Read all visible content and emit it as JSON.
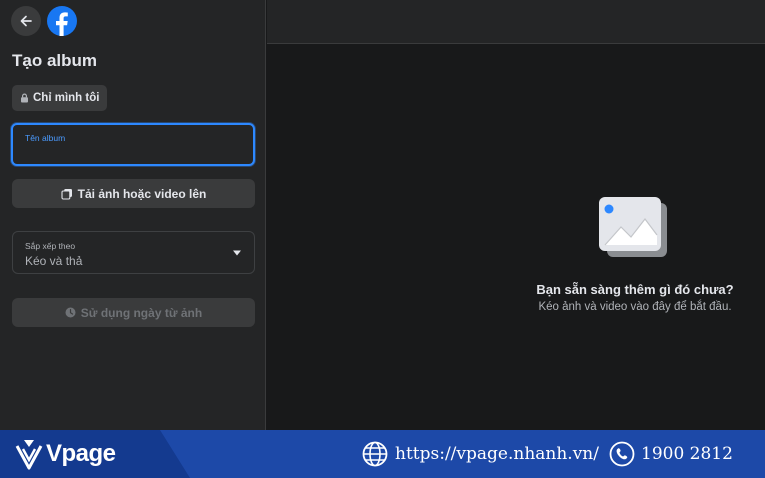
{
  "sidebar": {
    "back_icon": "arrow-left-icon",
    "logo_icon": "facebook-logo-icon",
    "title": "Tạo album",
    "privacy": {
      "icon": "lock-icon",
      "label": "Chỉ mình tôi"
    },
    "album_name": {
      "label": "Tên album",
      "value": ""
    },
    "upload": {
      "icon": "photo-stack-icon",
      "label": "Tải ảnh hoặc video lên"
    },
    "sort": {
      "label": "Sắp xếp theo",
      "value": "Kéo và thả",
      "icon": "caret-down-icon"
    },
    "use_date": {
      "icon": "clock-icon",
      "label": "Sử dụng ngày từ ảnh"
    }
  },
  "main": {
    "empty_icon": "photo-placeholder-icon",
    "empty_title": "Bạn sẵn sàng thêm gì đó chưa?",
    "empty_subtitle": "Kéo ảnh và video vào đây để bắt đầu."
  },
  "footer": {
    "brand": "Vpage",
    "brand_icon": "vpage-logo-icon",
    "website_icon": "globe-icon",
    "website": "https://vpage.nhanh.vn/",
    "phone_icon": "phone-icon",
    "phone": "1900 2812"
  },
  "colors": {
    "panel": "#242526",
    "background": "#18191a",
    "accent": "#2d88ff",
    "facebook_blue": "#1877f2",
    "banner": "#1d49a8"
  }
}
